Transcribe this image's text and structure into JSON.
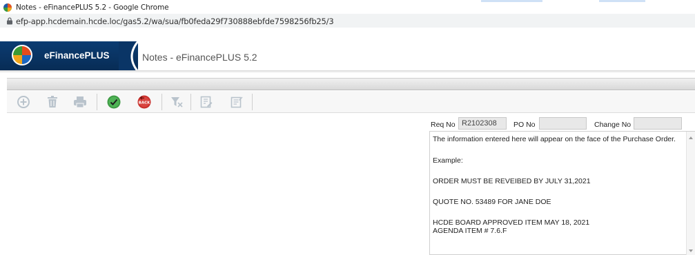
{
  "browser": {
    "window_title": "Notes - eFinancePLUS 5.2 - Google Chrome",
    "url": "efp-app.hcdemain.hcde.loc/gas5.2/wa/sua/fb0feda29f730888ebfde7598256fb25/3"
  },
  "app": {
    "brand": "eFinancePLUS",
    "page_title": "Notes - eFinancePLUS 5.2"
  },
  "toolbar": {
    "icons": [
      "add-icon",
      "delete-icon",
      "print-icon",
      "ok-icon",
      "back-icon",
      "filter-icon",
      "edit-icon",
      "notes-icon"
    ],
    "back_label": "BACK",
    "ok_label": "OK"
  },
  "fields": {
    "req_no_label": "Req No",
    "req_no_value": "R2102308",
    "po_no_label": "PO No",
    "po_no_value": "",
    "change_no_label": "Change No",
    "change_no_value": ""
  },
  "notes": {
    "lines": [
      "The information entered here will appear on the face of the Purchase Order.",
      "Example:",
      "ORDER MUST BE REVEIBED BY JULY 31,2021",
      "QUOTE NO. 53489 FOR JANE DOE",
      "HCDE BOARD APPROVED ITEM MAY 18, 2021",
      "AGENDA ITEM # 7.6.F"
    ]
  },
  "colors": {
    "brand_bg": "#0b3c72",
    "ok_green": "#3f9b45",
    "back_red": "#c9302c",
    "toolbar_disabled": "#b9c3cc"
  }
}
